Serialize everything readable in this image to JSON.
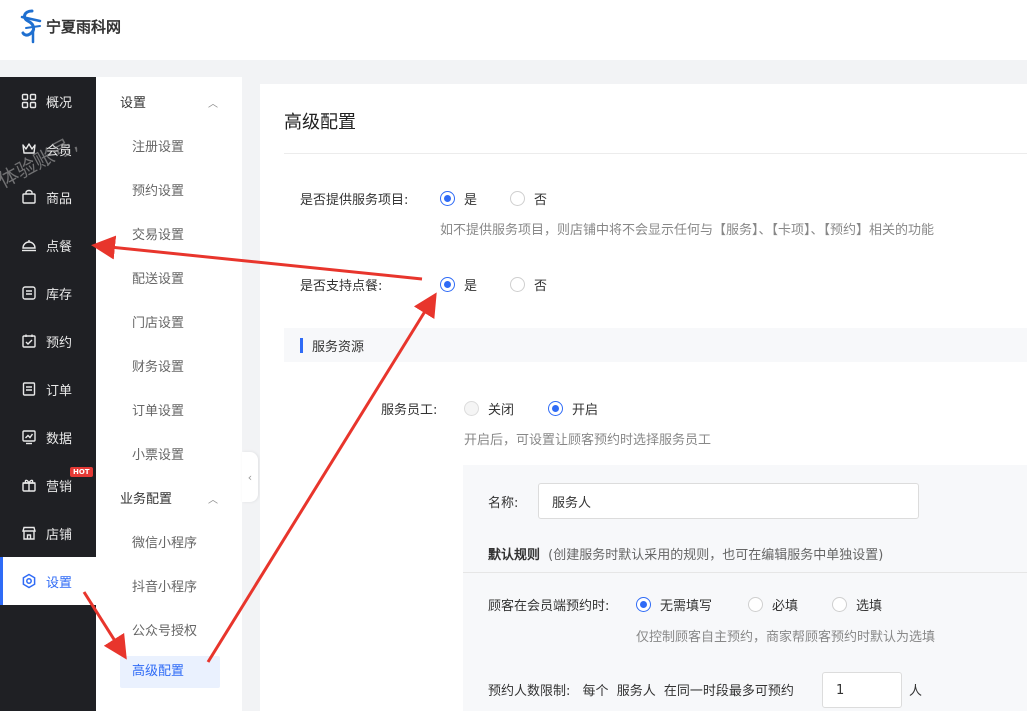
{
  "brand": {
    "name": "宁夏雨科网"
  },
  "sidebar": {
    "items": [
      {
        "label": "概况",
        "icon": "grid-icon"
      },
      {
        "label": "会员",
        "icon": "crown-icon"
      },
      {
        "label": "商品",
        "icon": "bag-icon"
      },
      {
        "label": "点餐",
        "icon": "dish-icon"
      },
      {
        "label": "库存",
        "icon": "inventory-icon"
      },
      {
        "label": "预约",
        "icon": "calendar-check-icon"
      },
      {
        "label": "订单",
        "icon": "order-icon"
      },
      {
        "label": "数据",
        "icon": "chart-icon"
      },
      {
        "label": "营销",
        "icon": "gift-icon",
        "badge": "HOT"
      },
      {
        "label": "店铺",
        "icon": "shop-icon"
      },
      {
        "label": "设置",
        "icon": "settings-icon",
        "active": true
      }
    ]
  },
  "watermark": "体验账号,",
  "subnav": {
    "groups": [
      {
        "title": "设置",
        "items": [
          "注册设置",
          "预约设置",
          "交易设置",
          "配送设置",
          "门店设置",
          "财务设置",
          "订单设置",
          "小票设置"
        ]
      },
      {
        "title": "业务配置",
        "items": [
          "微信小程序",
          "抖音小程序",
          "公众号授权",
          "高级配置"
        ]
      }
    ],
    "active_item": "高级配置"
  },
  "main": {
    "title": "高级配置",
    "provide_service": {
      "label": "是否提供服务项目:",
      "options": [
        "是",
        "否"
      ],
      "selected": "是",
      "hint": "如不提供服务项目，则店铺中将不会显示任何与【服务】、【卡项】、【预约】相关的功能"
    },
    "support_ordering": {
      "label": "是否支持点餐:",
      "options": [
        "是",
        "否"
      ],
      "selected": "是"
    },
    "section_title": "服务资源",
    "service_staff": {
      "label": "服务员工:",
      "options": [
        "关闭",
        "开启"
      ],
      "selected": "开启",
      "hint": "开启后，可设置让顾客预约时选择服务员工"
    },
    "panel": {
      "name_label": "名称:",
      "name_value": "服务人",
      "default_rule_title": "默认规则",
      "default_rule_note": "(创建服务时默认采用的规则，也可在编辑服务中单独设置)",
      "member_booking_label": "顾客在会员端预约时:",
      "member_booking_options": [
        "无需填写",
        "必填",
        "选填"
      ],
      "member_booking_selected": "无需填写",
      "member_booking_hint": "仅控制顾客自主预约，商家帮顾客预约时默认为选填",
      "limit_label": "预约人数限制:",
      "limit_prefix": "每个",
      "limit_role": "服务人",
      "limit_middle": "在同一时段最多可预约",
      "limit_value": "1",
      "limit_unit": "人"
    }
  },
  "colors": {
    "accent": "#2f6bf6",
    "sidebar_bg": "#1f2024",
    "annotation_red": "#e8352c"
  }
}
